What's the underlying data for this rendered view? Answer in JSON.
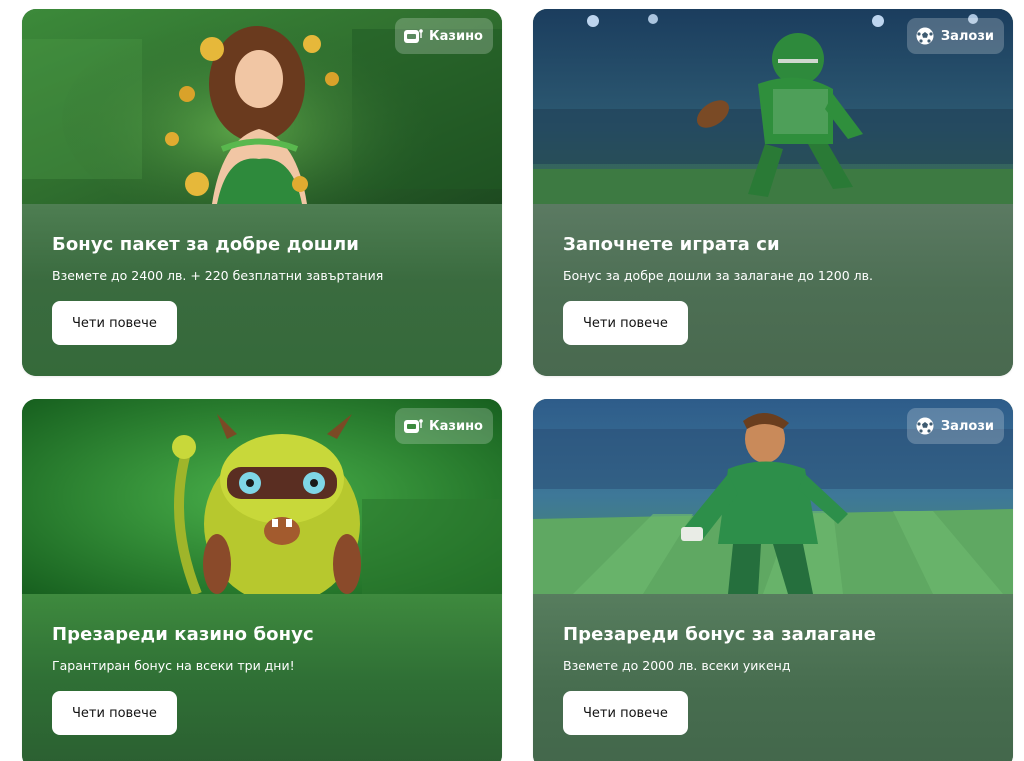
{
  "cards": [
    {
      "badge": {
        "label": "Казино",
        "icon": "slot-machine-icon"
      },
      "title": "Бонус пакет за добре дошли",
      "subtitle": "Вземете до 2400 лв. + 220 безплатни завъртания",
      "button": "Чети повече"
    },
    {
      "badge": {
        "label": "Залози",
        "icon": "soccer-ball-icon"
      },
      "title": "Започнете играта си",
      "subtitle": "Бонус за добре дошли за залагане до 1200 лв.",
      "button": "Чети повече"
    },
    {
      "badge": {
        "label": "Казино",
        "icon": "slot-machine-icon"
      },
      "title": "Презареди казино бонус",
      "subtitle": "Гарантиран бонус на всеки три дни!",
      "button": "Чети повече"
    },
    {
      "badge": {
        "label": "Залози",
        "icon": "soccer-ball-icon"
      },
      "title": "Презареди бонус за залагане",
      "subtitle": "Вземете до 2000 лв. всеки уикенд",
      "button": "Чети повече"
    }
  ],
  "colors": {
    "card_green": "#3f6a47",
    "button_bg": "#ffffff",
    "text_light": "#ffffff"
  }
}
